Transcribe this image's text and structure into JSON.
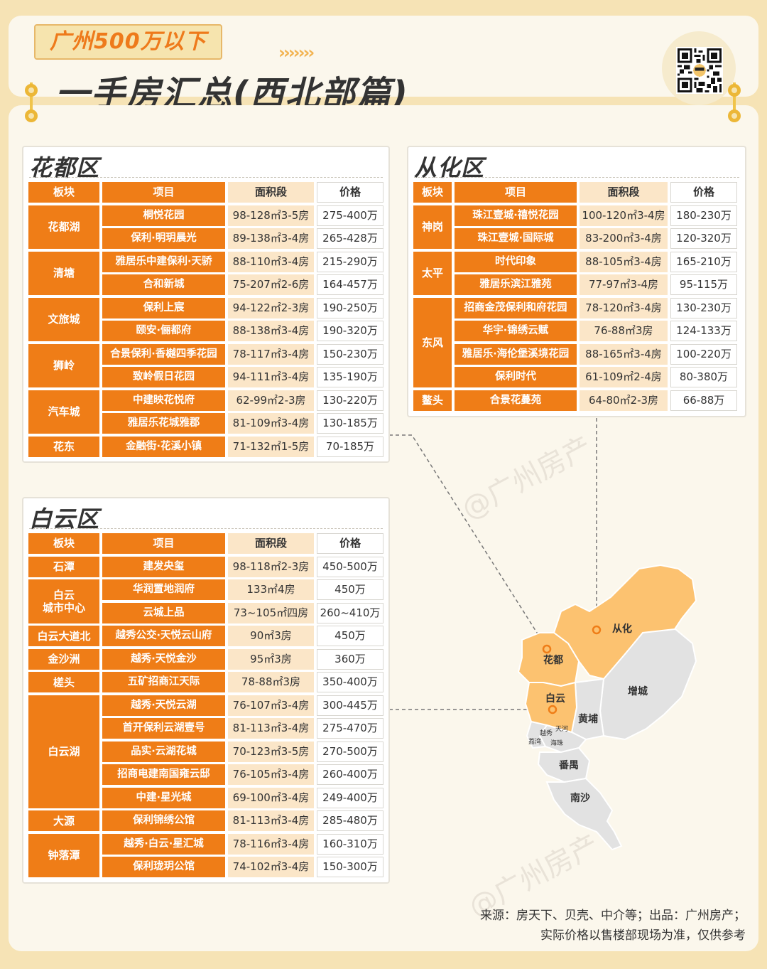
{
  "header": {
    "tag": "广州500万以下",
    "chevrons": "›››››››",
    "title": "一手房汇总(西北部篇)",
    "qr_label": "qr-code"
  },
  "columns": {
    "block": "板块",
    "project": "项目",
    "area": "面积段",
    "price": "价格"
  },
  "panels": {
    "huadu": {
      "title": "花都区",
      "groups": [
        {
          "block": "花都湖",
          "rows": [
            {
              "project": "桐悦花园",
              "area": "98-128㎡3-5房",
              "price": "275-400万"
            },
            {
              "project": "保利·明玥晨光",
              "area": "89-138㎡3-4房",
              "price": "265-428万"
            }
          ]
        },
        {
          "block": "清塘",
          "rows": [
            {
              "project": "雅居乐中建保利·天骄",
              "area": "88-110㎡3-4房",
              "price": "215-290万"
            },
            {
              "project": "合和新城",
              "area": "75-207㎡2-6房",
              "price": "164-457万"
            }
          ]
        },
        {
          "block": "文旅城",
          "rows": [
            {
              "project": "保利上宸",
              "area": "94-122㎡2-3房",
              "price": "190-250万"
            },
            {
              "project": "颐安·俪都府",
              "area": "88-138㎡3-4房",
              "price": "190-320万"
            }
          ]
        },
        {
          "block": "狮岭",
          "rows": [
            {
              "project": "合景保利·香樾四季花园",
              "area": "78-117㎡3-4房",
              "price": "150-230万"
            },
            {
              "project": "致岭假日花园",
              "area": "94-111㎡3-4房",
              "price": "135-190万"
            }
          ]
        },
        {
          "block": "汽车城",
          "rows": [
            {
              "project": "中建映花悦府",
              "area": "62-99㎡2-3房",
              "price": "130-220万"
            },
            {
              "project": "雅居乐花城雅郡",
              "area": "81-109㎡3-4房",
              "price": "130-185万"
            }
          ]
        },
        {
          "block": "花东",
          "rows": [
            {
              "project": "金融街·花溪小镇",
              "area": "71-132㎡1-5房",
              "price": "70-185万"
            }
          ]
        }
      ]
    },
    "conghua": {
      "title": "从化区",
      "groups": [
        {
          "block": "神岗",
          "rows": [
            {
              "project": "珠江壹城·禧悦花园",
              "area": "100-120㎡3-4房",
              "price": "180-230万"
            },
            {
              "project": "珠江壹城·国际城",
              "area": "83-200㎡3-4房",
              "price": "120-320万"
            }
          ]
        },
        {
          "block": "太平",
          "rows": [
            {
              "project": "时代印象",
              "area": "88-105㎡3-4房",
              "price": "165-210万"
            },
            {
              "project": "雅居乐滨江雅苑",
              "area": "77-97㎡3-4房",
              "price": "95-115万"
            }
          ]
        },
        {
          "block": "东风",
          "rows": [
            {
              "project": "招商金茂保利和府花园",
              "area": "78-120㎡3-4房",
              "price": "130-230万"
            },
            {
              "project": "华宇·锦绣云赋",
              "area": "76-88㎡3房",
              "price": "124-133万"
            },
            {
              "project": "雅居乐·海伦堡溪境花园",
              "area": "88-165㎡3-4房",
              "price": "100-220万"
            },
            {
              "project": "保利时代",
              "area": "61-109㎡2-4房",
              "price": "80-380万"
            }
          ]
        },
        {
          "block": "鳌头",
          "rows": [
            {
              "project": "合景花蔓苑",
              "area": "64-80㎡2-3房",
              "price": "66-88万"
            }
          ]
        }
      ]
    },
    "baiyun": {
      "title": "白云区",
      "groups": [
        {
          "block": "石潭",
          "rows": [
            {
              "project": "建发央玺",
              "area": "98-118㎡2-3房",
              "price": "450-500万"
            }
          ]
        },
        {
          "block": "白云城市中心",
          "block_lines": [
            "白云",
            "城市中心"
          ],
          "rows": [
            {
              "project": "华润置地润府",
              "area": "133㎡4房",
              "price": "450万"
            },
            {
              "project": "云城上品",
              "area": "73~105㎡四房",
              "price": "260~410万"
            }
          ]
        },
        {
          "block": "白云大道北",
          "rows": [
            {
              "project": "越秀公交·天悦云山府",
              "area": "90㎡3房",
              "price": "450万"
            }
          ]
        },
        {
          "block": "金沙洲",
          "rows": [
            {
              "project": "越秀·天悦金沙",
              "area": "95㎡3房",
              "price": "360万"
            }
          ]
        },
        {
          "block": "槎头",
          "rows": [
            {
              "project": "五矿招商江天际",
              "area": "78-88㎡3房",
              "price": "350-400万"
            }
          ]
        },
        {
          "block": "白云湖",
          "rows": [
            {
              "project": "越秀·天悦云湖",
              "area": "76-107㎡3-4房",
              "price": "300-445万"
            },
            {
              "project": "首开保利云湖壹号",
              "area": "81-113㎡3-4房",
              "price": "275-470万"
            },
            {
              "project": "品实·云湖花城",
              "area": "70-123㎡3-5房",
              "price": "270-500万"
            },
            {
              "project": "招商电建南国雍云邸",
              "area": "76-105㎡3-4房",
              "price": "260-400万"
            },
            {
              "project": "中建·星光城",
              "area": "69-100㎡3-4房",
              "price": "249-400万"
            }
          ]
        },
        {
          "block": "大源",
          "rows": [
            {
              "project": "保利锦绣公馆",
              "area": "81-113㎡3-4房",
              "price": "285-480万"
            }
          ]
        },
        {
          "block": "钟落潭",
          "rows": [
            {
              "project": "越秀·白云·星汇城",
              "area": "78-116㎡3-4房",
              "price": "160-310万"
            },
            {
              "project": "保利珑玥公馆",
              "area": "74-102㎡3-4房",
              "price": "150-300万"
            }
          ]
        }
      ]
    }
  },
  "map": {
    "labels": {
      "conghua": "从化",
      "huadu": "花都",
      "baiyun": "白云",
      "zengcheng": "增城",
      "huangpu": "黄埔",
      "tianhe": "天河",
      "yuexiu": "越秀",
      "liwan": "荔湾",
      "haizhu": "海珠",
      "panyu": "番禺",
      "nansha": "南沙"
    },
    "colors": {
      "highlight": "#f9bd62",
      "other": "#e4e4e4",
      "accent": "#ef7d17"
    }
  },
  "watermark": "@广州房产",
  "footer": {
    "line1": "来源：房天下、贝壳、中介等；出品：广州房产；",
    "line2": "实际价格以售楼部现场为准，仅供参考"
  }
}
